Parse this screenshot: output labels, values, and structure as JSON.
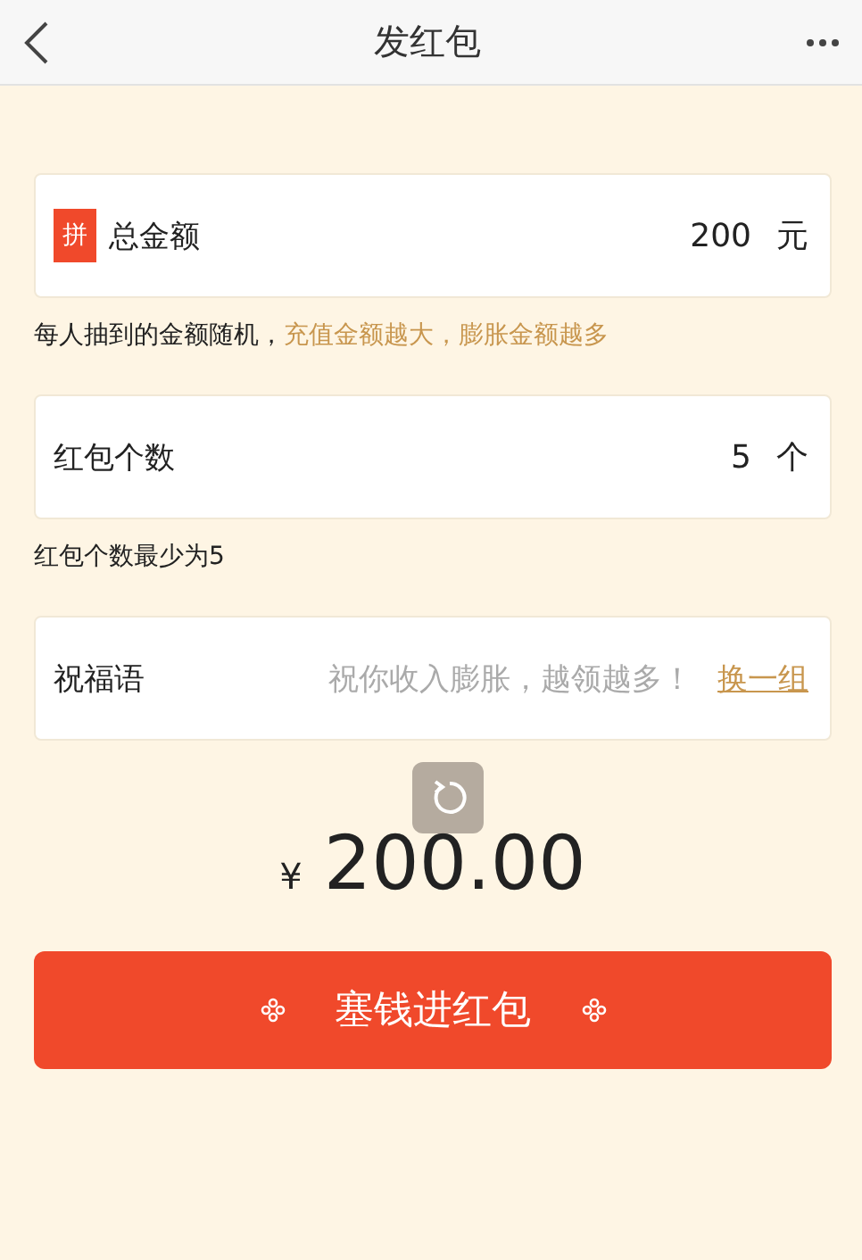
{
  "header": {
    "title": "发红包"
  },
  "total": {
    "badge": "拼",
    "label": "总金额",
    "value": "200",
    "unit": "元"
  },
  "total_hint": {
    "text": "每人抽到的金额随机，",
    "highlight": "充值金额越大，膨胀金额越多"
  },
  "count": {
    "label": "红包个数",
    "value": "5",
    "unit": "个"
  },
  "count_hint": "红包个数最少为5",
  "greeting": {
    "label": "祝福语",
    "placeholder": "祝你收入膨胀，越领越多！",
    "link": "换一组"
  },
  "amount": {
    "currency": "¥",
    "value": "200.00"
  },
  "submit": {
    "label": "塞钱进红包"
  }
}
